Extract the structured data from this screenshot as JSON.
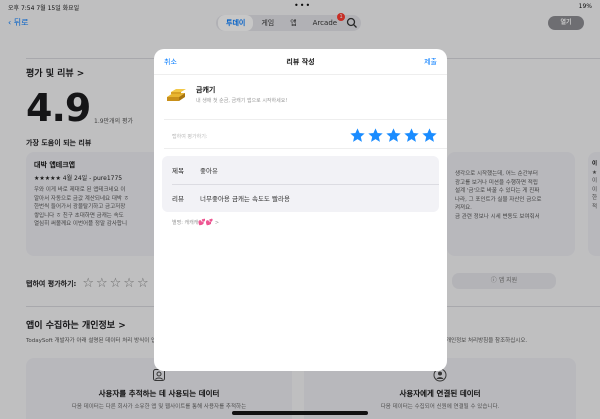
{
  "status_bar": {
    "time_date": "오후 7:54   7월 15일 화요일",
    "dots": "•••",
    "right": "19%"
  },
  "nav": {
    "back_label": "뒤로",
    "tabs": [
      {
        "label": "투데이",
        "active": true
      },
      {
        "label": "게임"
      },
      {
        "label": "앱"
      },
      {
        "label": "Arcade",
        "badge": "1"
      }
    ],
    "open_label": "열기"
  },
  "reviews": {
    "section_title": "평가 및 리뷰 >",
    "score": "4.9",
    "score_sub": "1.9만개의 평가",
    "helpful_title": "가장 도움이 되는 리뷰"
  },
  "card_left": {
    "title": "대박 앱테크앱",
    "meta": "★★★★★  4월 24일 - pure1775",
    "body": [
      "우와 이게 바로 제대로 된 앱테크네요 이",
      "알아서 자동으로 금값 계산되네요 대박 ㅎ",
      "한번씩 들어가서 광물탈기하고 금고저장",
      "쌓입니다 ㅎ 친구 초대하면 금캐는 속도",
      "열심히 써볼께요 이번어플 정말 감사합니"
    ]
  },
  "card_right": {
    "body": [
      "생각으로 시작했는데, 어느 순간부터",
      "광고를 보거나 미션을 수행하면 적립",
      "설계 '금'으로 바꿀 수 있다는 게 진짜",
      "나라, 그 포인트가 실물 자산인 금으로",
      "켜져요.",
      "금 관련 정보나 시세 변동도 보여줘서"
    ]
  },
  "card_edge": {
    "letters": [
      "이",
      "★",
      "이",
      "이",
      "한",
      "적"
    ]
  },
  "tap_rate": {
    "label": "탭하여 평가하기:",
    "stars": "☆☆☆☆☆"
  },
  "support_label": "앱 지원",
  "privacy": {
    "title": "앱이 수집하는 개인정보 >",
    "desc": "TodaySoft 개발자가 아래 설명된 데이터 처리 방식이 앱의",
    "desc_right": "개인정보 처리방침을 참조하십시오.",
    "left_title": "사용자를 추적하는 데 사용되는 데이터",
    "left_desc": "다음 데이터는 다른 회사가 소유한 앱 및 웹사이트를 통해 사용자를 추적하는",
    "right_title": "사용자에게 연결된 데이터",
    "right_desc": "다음 데이터는 수집되어 신원에 연결될 수 있습니다."
  },
  "modal": {
    "cancel": "취소",
    "title": "리뷰 작성",
    "submit": "제출",
    "app_name": "금캐기",
    "app_desc": "내 생애 첫 순금, 금캐기 앱으로 시작하세요!",
    "rate_label": "탭하여 평가하기:",
    "stars_filled": 5,
    "fields": [
      {
        "label": "제목",
        "value": "좋아유"
      },
      {
        "label": "리뷰",
        "value": "너무좋아용 금캐는 속도도 빨라용"
      }
    ],
    "meta_text": "별명: 캐캐캐",
    "meta_hearts": "💕💕",
    "meta_chevron": ">"
  },
  "colors": {
    "accent": "#007aff",
    "star": "#1a8cff"
  }
}
